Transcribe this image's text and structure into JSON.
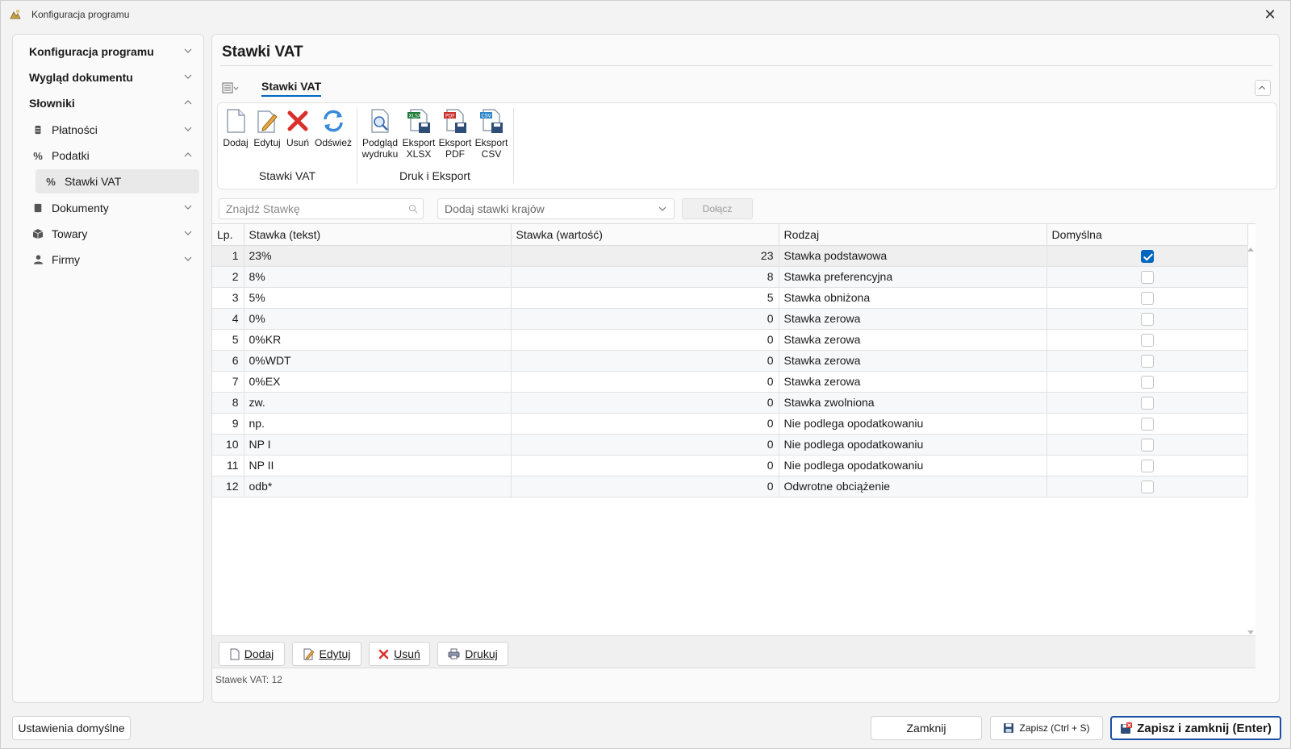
{
  "window": {
    "title": "Konfiguracja programu"
  },
  "sidebar": {
    "items": [
      {
        "label": "Konfiguracja programu",
        "expanded": false
      },
      {
        "label": "Wygląd dokumentu",
        "expanded": false
      },
      {
        "label": "Słowniki",
        "expanded": true
      },
      {
        "label": "Płatności",
        "icon": "cash-icon",
        "expanded": false
      },
      {
        "label": "Podatki",
        "icon": "percent-icon",
        "expanded": true
      },
      {
        "label": "Stawki VAT",
        "icon": "percent-icon",
        "selected": true
      },
      {
        "label": "Dokumenty",
        "icon": "document-icon",
        "expanded": false
      },
      {
        "label": "Towary",
        "icon": "box-icon",
        "expanded": false
      },
      {
        "label": "Firmy",
        "icon": "person-icon",
        "expanded": false
      }
    ]
  },
  "main": {
    "title": "Stawki VAT",
    "ribbon_tab": "Stawki VAT",
    "ribbon": {
      "groups": [
        {
          "label": "Stawki VAT",
          "buttons": [
            "Dodaj",
            "Edytuj",
            "Usuń",
            "Odśwież"
          ]
        },
        {
          "label": "Druk i Eksport",
          "buttons": [
            {
              "line1": "Podgląd",
              "line2": "wydruku"
            },
            {
              "line1": "Eksport",
              "line2": "XLSX"
            },
            {
              "line1": "Eksport",
              "line2": "PDF"
            },
            {
              "line1": "Eksport",
              "line2": "CSV"
            }
          ]
        }
      ]
    },
    "search": {
      "placeholder": "Znajdź Stawkę"
    },
    "combo": {
      "placeholder": "Dodaj stawki krajów"
    },
    "join_label": "Dołącz",
    "table": {
      "columns": [
        "Lp.",
        "Stawka (tekst)",
        "Stawka (wartość)",
        "Rodzaj",
        "Domyślna"
      ],
      "rows": [
        {
          "lp": "1",
          "text": "23%",
          "value": "23",
          "type": "Stawka podstawowa",
          "default": true
        },
        {
          "lp": "2",
          "text": "8%",
          "value": "8",
          "type": "Stawka preferencyjna",
          "default": false
        },
        {
          "lp": "3",
          "text": "5%",
          "value": "5",
          "type": "Stawka obniżona",
          "default": false
        },
        {
          "lp": "4",
          "text": "0%",
          "value": "0",
          "type": "Stawka zerowa",
          "default": false
        },
        {
          "lp": "5",
          "text": "0%KR",
          "value": "0",
          "type": "Stawka zerowa",
          "default": false
        },
        {
          "lp": "6",
          "text": "0%WDT",
          "value": "0",
          "type": "Stawka zerowa",
          "default": false
        },
        {
          "lp": "7",
          "text": "0%EX",
          "value": "0",
          "type": "Stawka zerowa",
          "default": false
        },
        {
          "lp": "8",
          "text": "zw.",
          "value": "0",
          "type": "Stawka zwolniona",
          "default": false
        },
        {
          "lp": "9",
          "text": "np.",
          "value": "0",
          "type": "Nie podlega opodatkowaniu",
          "default": false
        },
        {
          "lp": "10",
          "text": "NP I",
          "value": "0",
          "type": "Nie podlega opodatkowaniu",
          "default": false
        },
        {
          "lp": "11",
          "text": "NP II",
          "value": "0",
          "type": "Nie podlega opodatkowaniu",
          "default": false
        },
        {
          "lp": "12",
          "text": "odb*",
          "value": "0",
          "type": "Odwrotne obciążenie",
          "default": false
        }
      ]
    },
    "actions": {
      "add": "Dodaj",
      "edit": "Edytuj",
      "delete": "Usuń",
      "print": "Drukuj"
    },
    "status": "Stawek VAT: 12"
  },
  "footer": {
    "defaults": "Ustawienia domyślne",
    "close": "Zamknij",
    "save": "Zapisz (Ctrl + S)",
    "save_close": "Zapisz i zamknij (Enter)"
  },
  "colors": {
    "accent": "#0067c0",
    "primary_border": "#1b4fa6",
    "delete_red": "#d9302c"
  }
}
